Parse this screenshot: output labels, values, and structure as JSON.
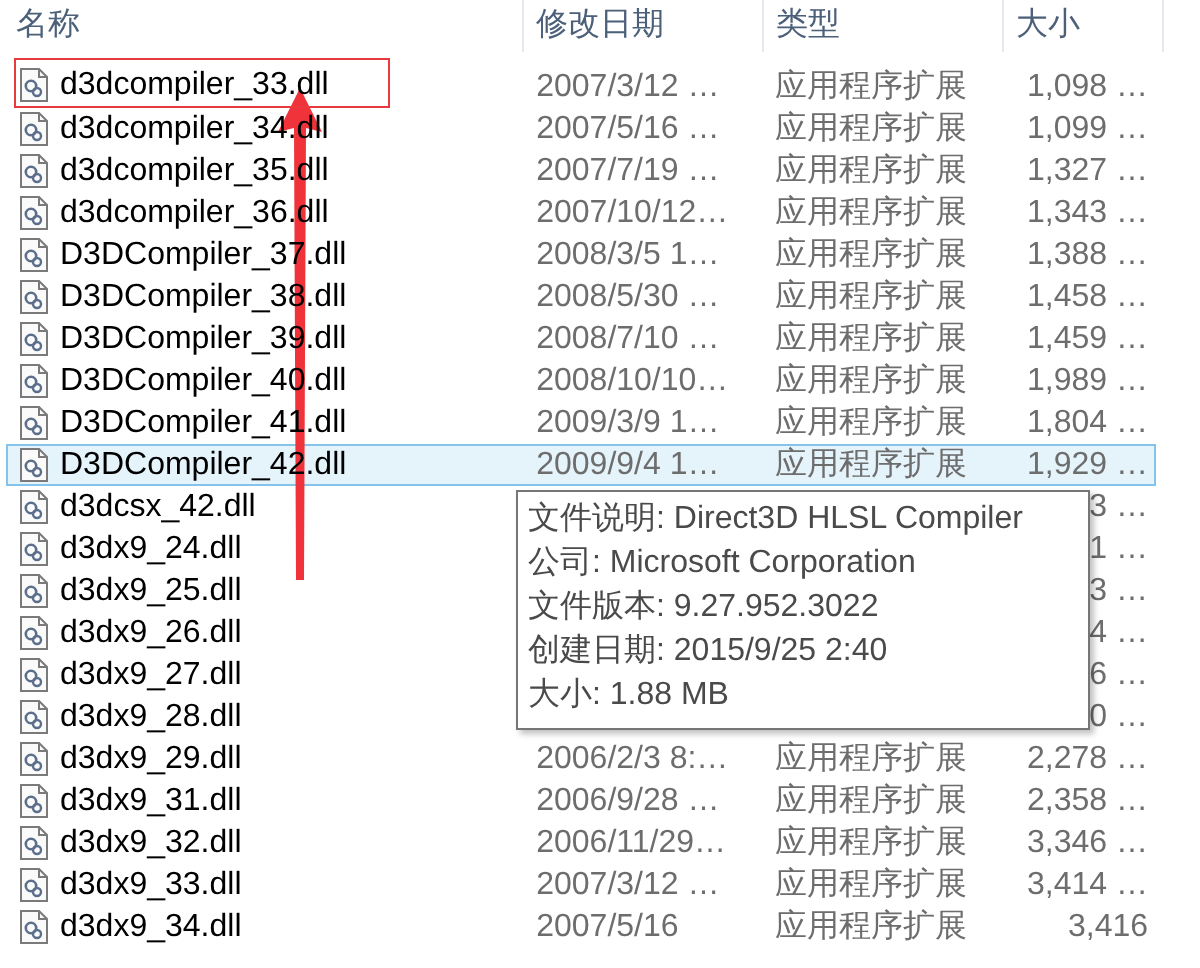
{
  "columns": [
    {
      "label": "名称"
    },
    {
      "label": "修改日期"
    },
    {
      "label": "类型"
    },
    {
      "label": "大小"
    }
  ],
  "rows": [
    {
      "name": "d3dcompiler_33.dll",
      "date": "2007/3/12 …",
      "type": "应用程序扩展",
      "size": "1,098 …",
      "selected": false,
      "framed": true
    },
    {
      "name": "d3dcompiler_34.dll",
      "date": "2007/5/16 …",
      "type": "应用程序扩展",
      "size": "1,099 …",
      "selected": false
    },
    {
      "name": "d3dcompiler_35.dll",
      "date": "2007/7/19 …",
      "type": "应用程序扩展",
      "size": "1,327 …",
      "selected": false
    },
    {
      "name": "d3dcompiler_36.dll",
      "date": "2007/10/12…",
      "type": "应用程序扩展",
      "size": "1,343 …",
      "selected": false
    },
    {
      "name": "D3DCompiler_37.dll",
      "date": "2008/3/5 1…",
      "type": "应用程序扩展",
      "size": "1,388 …",
      "selected": false
    },
    {
      "name": "D3DCompiler_38.dll",
      "date": "2008/5/30 …",
      "type": "应用程序扩展",
      "size": "1,458 …",
      "selected": false
    },
    {
      "name": "D3DCompiler_39.dll",
      "date": "2008/7/10 …",
      "type": "应用程序扩展",
      "size": "1,459 …",
      "selected": false
    },
    {
      "name": "D3DCompiler_40.dll",
      "date": "2008/10/10…",
      "type": "应用程序扩展",
      "size": "1,989 …",
      "selected": false
    },
    {
      "name": "D3DCompiler_41.dll",
      "date": "2009/3/9 1…",
      "type": "应用程序扩展",
      "size": "1,804 …",
      "selected": false
    },
    {
      "name": "D3DCompiler_42.dll",
      "date": "2009/9/4 1…",
      "type": "应用程序扩展",
      "size": "1,929 …",
      "selected": true
    },
    {
      "name": "d3dcsx_42.dll",
      "size": "3 …",
      "selected": false
    },
    {
      "name": "d3dx9_24.dll",
      "size": "1 …",
      "selected": false
    },
    {
      "name": "d3dx9_25.dll",
      "size": "3 …",
      "selected": false
    },
    {
      "name": "d3dx9_26.dll",
      "size": "4 …",
      "selected": false
    },
    {
      "name": "d3dx9_27.dll",
      "size": "6 …",
      "selected": false
    },
    {
      "name": "d3dx9_28.dll",
      "size": "0 …",
      "selected": false
    },
    {
      "name": "d3dx9_29.dll",
      "date": "2006/2/3 8:…",
      "type": "应用程序扩展",
      "size": "2,278 …",
      "selected": false
    },
    {
      "name": "d3dx9_31.dll",
      "date": "2006/9/28 …",
      "type": "应用程序扩展",
      "size": "2,358 …",
      "selected": false
    },
    {
      "name": "d3dx9_32.dll",
      "date": "2006/11/29…",
      "type": "应用程序扩展",
      "size": "3,346 …",
      "selected": false
    },
    {
      "name": "d3dx9_33.dll",
      "date": "2007/3/12 …",
      "type": "应用程序扩展",
      "size": "3,414 …",
      "selected": false
    },
    {
      "name": "d3dx9_34.dll",
      "date": "2007/5/16",
      "type": "应用程序扩展",
      "size": "3,416",
      "selected": false
    }
  ],
  "tooltip": {
    "lines": [
      "文件说明: Direct3D HLSL Compiler",
      "公司: Microsoft Corporation",
      "文件版本: 9.27.952.3022",
      "创建日期: 2015/9/25 2:40",
      "大小: 1.88 MB"
    ]
  },
  "annotations": [
    {
      "kind": "arrow"
    }
  ]
}
